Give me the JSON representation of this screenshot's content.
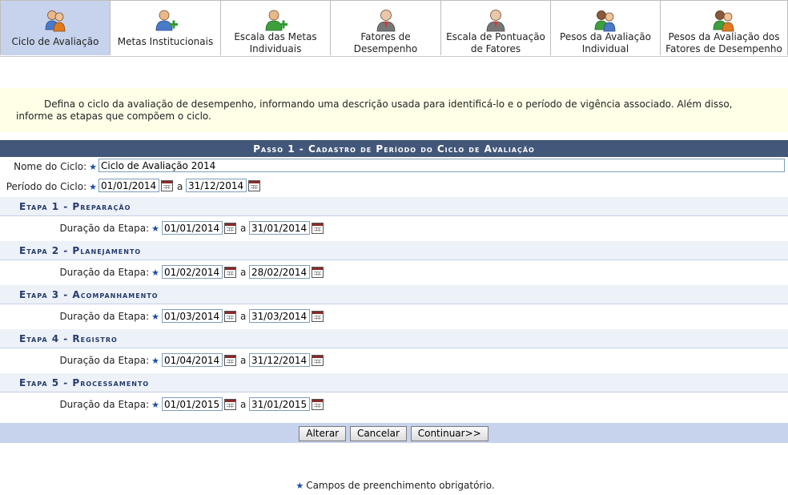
{
  "tabs": [
    {
      "label": "Ciclo de Avaliação",
      "icon": "people-icon",
      "active": true
    },
    {
      "label": "Metas Institucionais",
      "icon": "user-add-icon",
      "active": false
    },
    {
      "label": "Escala das Metas Individuais",
      "icon": "user-add-icon",
      "active": false
    },
    {
      "label": "Fatores de Desempenho",
      "icon": "user-icon",
      "active": false
    },
    {
      "label": "Escala de Pontuação de Fatores",
      "icon": "user-icon",
      "active": false
    },
    {
      "label": "Pesos da Avaliação Individual",
      "icon": "people-icon",
      "active": false
    },
    {
      "label": "Pesos da Avaliação dos Fatores de Desempenho",
      "icon": "people-icon",
      "active": false
    }
  ],
  "instructions": "Defina o ciclo da avaliação de desempenho, informando uma descrição usada para identificá-lo e o período de vigência associado. Além disso, informe as etapas que compõem o ciclo.",
  "form": {
    "caption": "Passo 1 - Cadastro de Período do Ciclo de Avaliação",
    "nome_label": "Nome do Ciclo:",
    "nome_value": "Ciclo de Avaliação 2014",
    "periodo_label": "Período do Ciclo:",
    "periodo_inicio": "01/01/2014",
    "periodo_fim": "31/12/2014",
    "separator": "a",
    "duracao_label": "Duração da Etapa:",
    "stages": [
      {
        "title": "Etapa 1 - Preparação",
        "inicio": "01/01/2014",
        "fim": "31/01/2014"
      },
      {
        "title": "Etapa 2 - Planejamento",
        "inicio": "01/02/2014",
        "fim": "28/02/2014"
      },
      {
        "title": "Etapa 3 - Acompanhamento",
        "inicio": "01/03/2014",
        "fim": "31/03/2014"
      },
      {
        "title": "Etapa 4 - Registro",
        "inicio": "01/04/2014",
        "fim": "31/12/2014"
      },
      {
        "title": "Etapa 5 - Processamento",
        "inicio": "01/01/2015",
        "fim": "31/01/2015"
      }
    ],
    "buttons": {
      "alterar": "Alterar",
      "cancelar": "Cancelar",
      "continuar": "Continuar>>"
    }
  },
  "required_note": "Campos de preenchimento obrigatório.",
  "required_star": "★",
  "colors": {
    "caption_bg": "#42577a",
    "active_tab_bg": "#c7d3ec",
    "instructions_bg": "#ffffe8",
    "stage_text": "#253b6b"
  }
}
